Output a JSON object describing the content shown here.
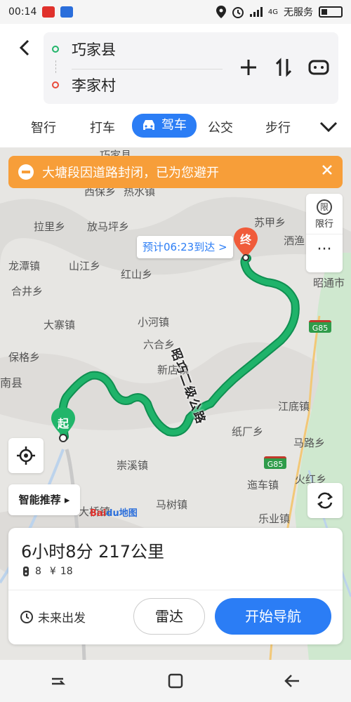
{
  "status_bar": {
    "time": "00:14",
    "network_status": "无服务",
    "network_tag": "4G",
    "icons": [
      "weibo-icon",
      "baidu-icon",
      "location-icon",
      "alarm-icon",
      "signal-icon",
      "battery-icon"
    ]
  },
  "route": {
    "origin": "巧家县",
    "destination": "李家村"
  },
  "mode_tabs": [
    "智行",
    "打车",
    "驾车",
    "公交",
    "步行"
  ],
  "active_tab": "驾车",
  "alert": {
    "message": "大塘段因道路封闭，已为您避开"
  },
  "side_panel": {
    "xianxing_mark": "限",
    "xianxing_label": "限行",
    "more_label": "···"
  },
  "map": {
    "eta": "预计06:23到达 >",
    "end_marker": "终",
    "start_marker": "起",
    "road_name": "昭巧二级公路",
    "smart_recommend": "智能推荐",
    "baidu_logo_a": "Bai",
    "baidu_logo_b": "du地图",
    "highway_shields": [
      "G85",
      "G85"
    ],
    "places": [
      "巧家县",
      "西保乡",
      "热水镇",
      "拉里乡",
      "放马坪乡",
      "苏甲乡",
      "洒渔",
      "龙潭镇",
      "山江乡",
      "红山乡",
      "昭通市",
      "合井乡",
      "小河镇",
      "大寨镇",
      "六合乡",
      "新店镇",
      "保格乡",
      "南县",
      "江底镇",
      "纸厂乡",
      "马路乡",
      "崇溪镇",
      "迤车镇",
      "火红乡",
      "马树镇",
      "乐业镇",
      "大桥镇"
    ]
  },
  "route_card": {
    "summary": "6小时8分  217公里",
    "traffic_lights": "8",
    "toll_symbol": "¥",
    "toll": "18",
    "future_label": "未来出发",
    "radar_label": "雷达",
    "start_nav_label": "开始导航"
  },
  "colors": {
    "accent": "#2b7df5",
    "route": "#1fb36a",
    "alert": "#f79e39",
    "start": "#21b56a",
    "end": "#f05b3a"
  }
}
